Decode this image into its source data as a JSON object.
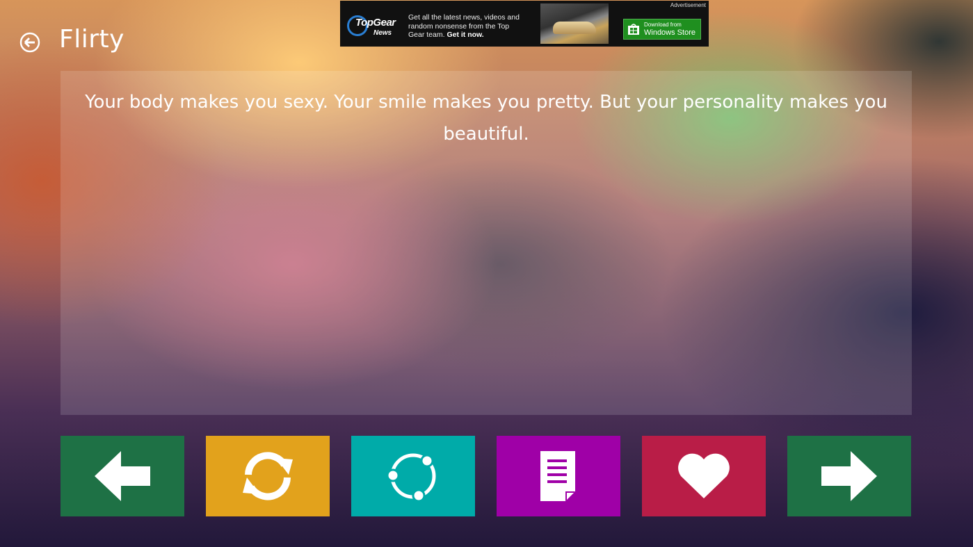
{
  "header": {
    "title": "Flirty",
    "back_icon": "back-arrow-circle-icon"
  },
  "ad": {
    "label": "Advertisement",
    "logo_main": "TopGear",
    "logo_sub": "News",
    "text_line1": "Get all the latest news, videos and",
    "text_line2": "random nonsense from the Top",
    "text_line3": "Gear team.",
    "cta": "Get it now.",
    "store_top": "Download from",
    "store_bottom": "Windows Store"
  },
  "quote": {
    "text": "Your body makes you sexy. Your smile makes you pretty. But your personality makes you beautiful."
  },
  "toolbar": {
    "tiles": [
      {
        "name": "previous",
        "icon": "arrow-left-icon",
        "color": "#1e7145"
      },
      {
        "name": "refresh",
        "icon": "refresh-icon",
        "color": "#e2a21c"
      },
      {
        "name": "share",
        "icon": "share-icon",
        "color": "#00aba9"
      },
      {
        "name": "copy",
        "icon": "document-icon",
        "color": "#9f00a7"
      },
      {
        "name": "favorite",
        "icon": "heart-icon",
        "color": "#b91d47"
      },
      {
        "name": "next",
        "icon": "arrow-right-icon",
        "color": "#1e7145"
      }
    ]
  }
}
